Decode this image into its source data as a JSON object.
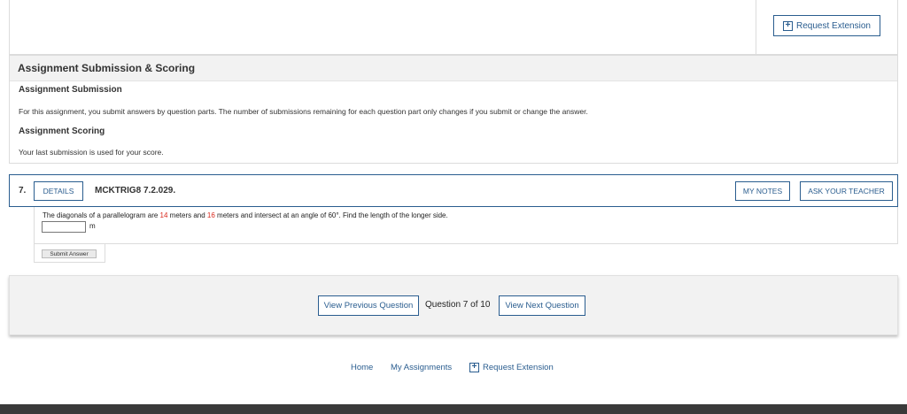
{
  "top": {
    "request_extension": "Request Extension"
  },
  "scoring": {
    "title": "Assignment Submission & Scoring",
    "submission_heading": "Assignment Submission",
    "submission_text": "For this assignment, you submit answers by question parts. The number of submissions remaining for each question part only changes if you submit or change the answer.",
    "scoring_heading": "Assignment Scoring",
    "scoring_text": "Your last submission is used for your score."
  },
  "question": {
    "number": "7.",
    "details_label": "DETAILS",
    "code": "MCKTRIG8 7.2.029.",
    "my_notes_label": "MY NOTES",
    "ask_teacher_label": "ASK YOUR TEACHER",
    "text_part1": "The diagonals of a parallelogram are ",
    "value1": "14",
    "text_part2": " meters and ",
    "value2": "16",
    "text_part3": " meters and intersect at an angle of 60°. Find the length of the longer side.",
    "answer_value": "",
    "unit": "m",
    "submit_label": "Submit Answer"
  },
  "nav": {
    "prev_label": "View Previous Question",
    "counter": "Question 7 of 10",
    "next_label": "View Next Question"
  },
  "footer": {
    "home": "Home",
    "my_assignments": "My Assignments",
    "request_extension": "Request Extension"
  },
  "colors": {
    "accent": "#2a5d8f",
    "highlight_red": "#d9281c",
    "panel_gray": "#f2f2f2",
    "bottom_bar": "#3a3a3a"
  }
}
